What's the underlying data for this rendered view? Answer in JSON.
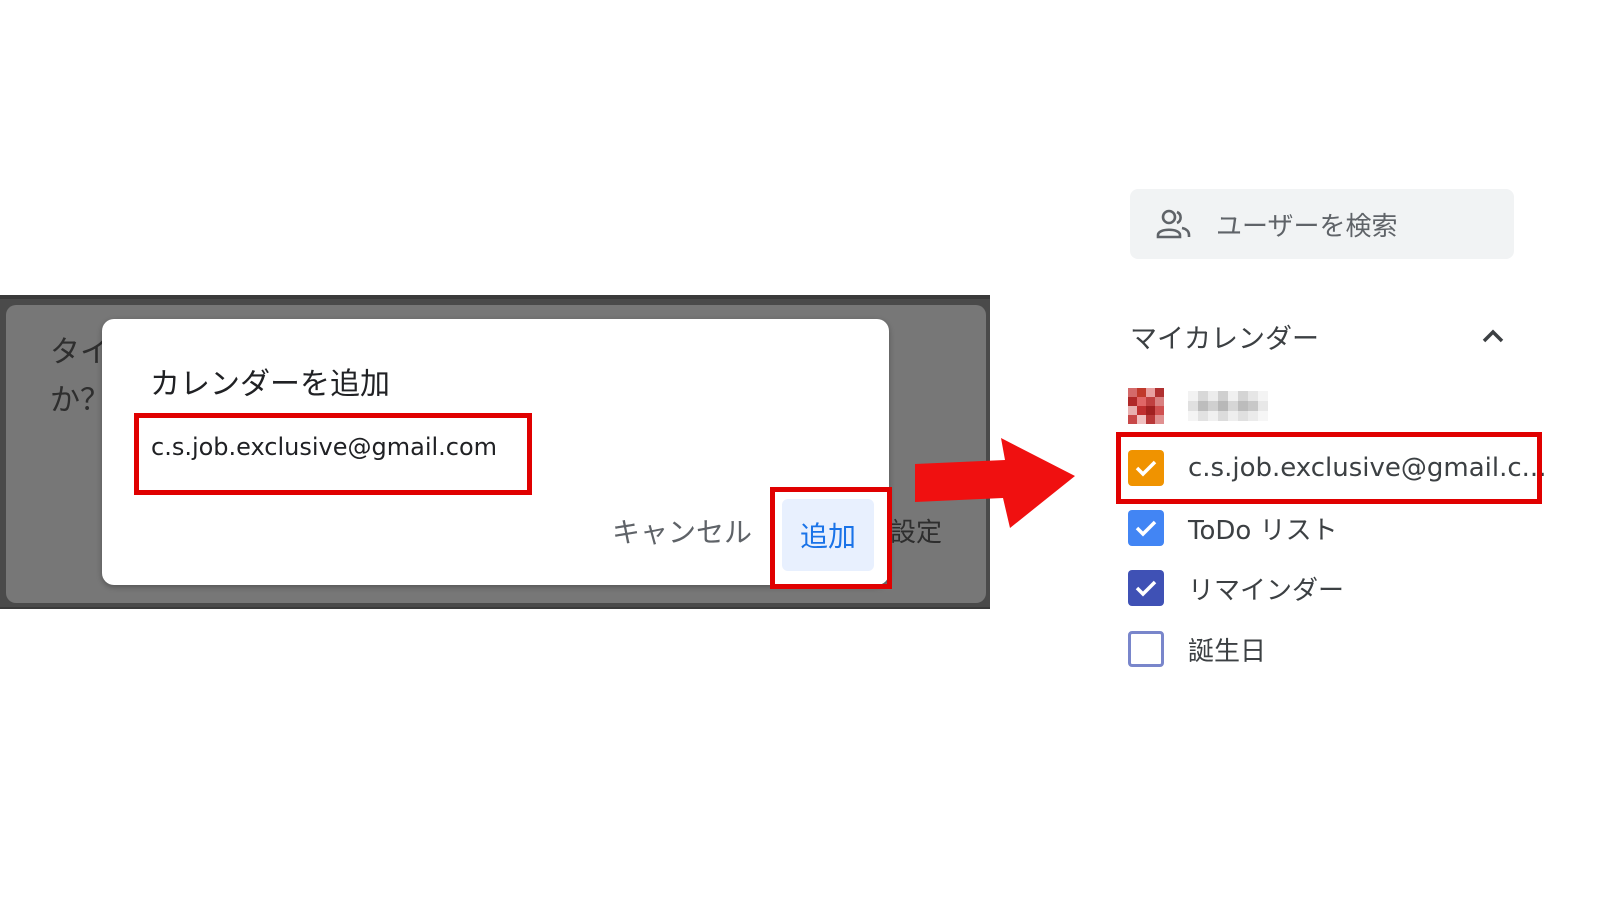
{
  "background_page": {
    "text_line1": "タイ",
    "text_line2": "か？",
    "text_right": "設定"
  },
  "dialog": {
    "title": "カレンダーを追加",
    "input_value": "c.s.job.exclusive@gmail.com",
    "cancel_label": "キャンセル",
    "add_label": "追加"
  },
  "sidebar": {
    "search_placeholder": "ユーザーを検索",
    "section_title": "マイカレンダー",
    "calendars": [
      {
        "label": "c.s.job.exclusive@gmail.c...",
        "checked": true,
        "color": "#f09300"
      },
      {
        "label": "ToDo リスト",
        "checked": true,
        "color": "#4285f4"
      },
      {
        "label": "リマインダー",
        "checked": true,
        "color": "#3f51b5"
      },
      {
        "label": "誕生日",
        "checked": false,
        "color": "#7986cb"
      }
    ]
  },
  "colors": {
    "highlight": "#e00000",
    "arrow": "#f01010",
    "link_blue": "#1a73e8"
  },
  "icons": {
    "search": "people-icon",
    "section_toggle": "chevron-up-icon",
    "check": "check-icon",
    "arrow": "right-arrow-icon"
  }
}
